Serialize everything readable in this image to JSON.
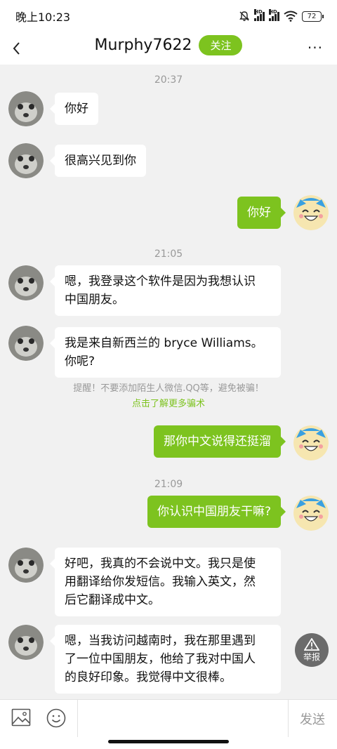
{
  "status_bar": {
    "time": "晚上10:23",
    "hd1": "HD",
    "hd2": "HD",
    "battery": "72"
  },
  "header": {
    "title": "Murphy7622",
    "follow_label": "关注",
    "more_icon": "more-dots-icon",
    "back_icon": "chevron-left-icon"
  },
  "messages": [
    {
      "type": "timestamp",
      "text": "20:37"
    },
    {
      "type": "incoming",
      "text": "你好"
    },
    {
      "type": "incoming",
      "text": "很高兴见到你"
    },
    {
      "type": "outgoing",
      "text": "你好"
    },
    {
      "type": "timestamp",
      "text": "21:05"
    },
    {
      "type": "incoming",
      "lines": [
        "嗯，我登录这个软件是因为我想认识",
        "中国朋友。"
      ]
    },
    {
      "type": "incoming",
      "lines": [
        "我是来自新西兰的 bryce Williams。",
        "你呢?"
      ]
    },
    {
      "type": "outgoing",
      "text": "那你中文说得还挺溜"
    },
    {
      "type": "timestamp",
      "text": "21:09"
    },
    {
      "type": "outgoing",
      "text": "你认识中国朋友干嘛?"
    },
    {
      "type": "incoming",
      "lines": [
        "好吧，我真的不会说中文。我只是使",
        "用翻译给你发短信。我输入英文，然",
        "后它翻译成中文。"
      ]
    },
    {
      "type": "incoming",
      "lines": [
        "嗯，当我访问越南时，我在那里遇到",
        "了一位中国朋友，他给了我对中国人",
        "的良好印象。我觉得中文很棒。"
      ]
    }
  ],
  "warning": {
    "text": "提醒！不要添加陌生人微信.QQ等，避免被骗！",
    "link": "点击了解更多骗术"
  },
  "report_label": "举报",
  "input_bar": {
    "send_label": "发送",
    "image_icon": "image-icon",
    "emoji_icon": "emoji-icon"
  },
  "colors": {
    "accent": "#7dc31f",
    "background": "#f1f1f1"
  }
}
